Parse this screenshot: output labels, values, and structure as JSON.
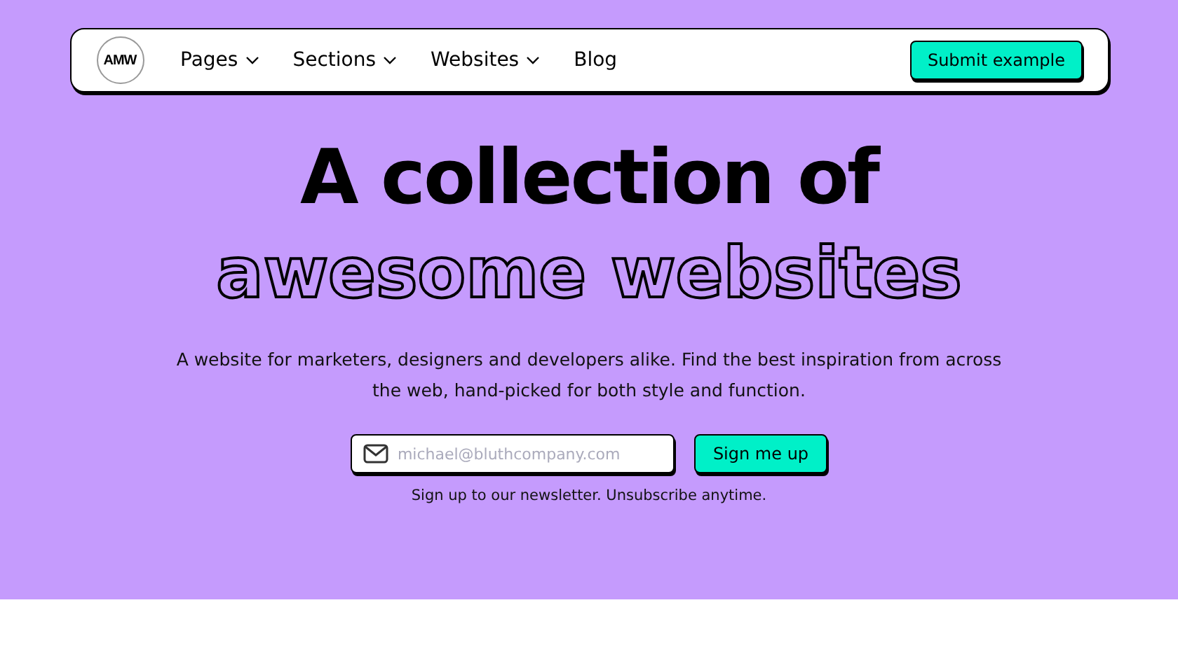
{
  "nav": {
    "logo": "AMW",
    "items": [
      {
        "label": "Pages",
        "dropdown": true
      },
      {
        "label": "Sections",
        "dropdown": true
      },
      {
        "label": "Websites",
        "dropdown": true
      },
      {
        "label": "Blog",
        "dropdown": false
      }
    ],
    "action": "Submit example"
  },
  "hero": {
    "title": "A collection of",
    "title_outlined": "awesome websites",
    "description": "A website for marketers, designers and developers alike. Find the best inspiration from across the web, hand-picked for both style and function.",
    "email": {
      "placeholder": "michael@bluthcompany.com"
    },
    "button": "Sign me up",
    "note": "Sign up to our newsletter. Unsubscribe anytime."
  }
}
